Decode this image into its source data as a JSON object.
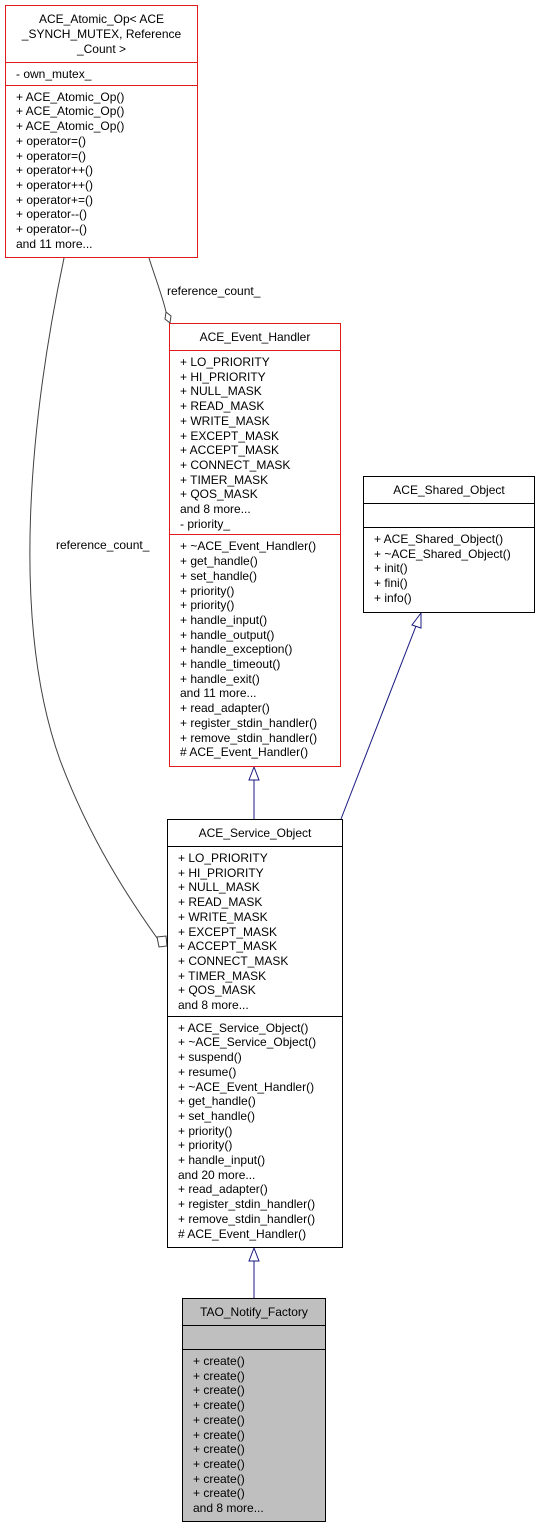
{
  "diagram": {
    "colors": {
      "red_border": "#e01b1b",
      "inherit_edge": "#1a1a80",
      "member_edge": "#404040",
      "focus_fill": "#bfbfbf"
    },
    "classes": {
      "atomic_op": {
        "title_lines": [
          "ACE_Atomic_Op< ACE",
          "_SYNCH_MUTEX, Reference",
          "_Count >"
        ],
        "attributes": [
          "- own_mutex_"
        ],
        "methods": [
          "+ ACE_Atomic_Op()",
          "+ ACE_Atomic_Op()",
          "+ ACE_Atomic_Op()",
          "+ operator=()",
          "+ operator=()",
          "+ operator++()",
          "+ operator++()",
          "+ operator+=()",
          "+ operator--()",
          "+ operator--()",
          "and 11 more..."
        ]
      },
      "event_handler": {
        "title": "ACE_Event_Handler",
        "attributes": [
          "+ LO_PRIORITY",
          "+ HI_PRIORITY",
          "+ NULL_MASK",
          "+ READ_MASK",
          "+ WRITE_MASK",
          "+ EXCEPT_MASK",
          "+ ACCEPT_MASK",
          "+ CONNECT_MASK",
          "+ TIMER_MASK",
          "+ QOS_MASK",
          "and 8 more...",
          "- priority_"
        ],
        "methods": [
          "+ ~ACE_Event_Handler()",
          "+ get_handle()",
          "+ set_handle()",
          "+ priority()",
          "+ priority()",
          "+ handle_input()",
          "+ handle_output()",
          "+ handle_exception()",
          "+ handle_timeout()",
          "+ handle_exit()",
          "and 11 more...",
          "+ read_adapter()",
          "+ register_stdin_handler()",
          "+ remove_stdin_handler()",
          "# ACE_Event_Handler()"
        ]
      },
      "shared_object": {
        "title": "ACE_Shared_Object",
        "attributes": [],
        "methods": [
          "+ ACE_Shared_Object()",
          "+ ~ACE_Shared_Object()",
          "+ init()",
          "+ fini()",
          "+ info()"
        ]
      },
      "service_object": {
        "title": "ACE_Service_Object",
        "attributes": [
          "+ LO_PRIORITY",
          "+ HI_PRIORITY",
          "+ NULL_MASK",
          "+ READ_MASK",
          "+ WRITE_MASK",
          "+ EXCEPT_MASK",
          "+ ACCEPT_MASK",
          "+ CONNECT_MASK",
          "+ TIMER_MASK",
          "+ QOS_MASK",
          "and 8 more..."
        ],
        "methods": [
          "+ ACE_Service_Object()",
          "+ ~ACE_Service_Object()",
          "+ suspend()",
          "+ resume()",
          "+ ~ACE_Event_Handler()",
          "+ get_handle()",
          "+ set_handle()",
          "+ priority()",
          "+ priority()",
          "+ handle_input()",
          "and 20 more...",
          "+ read_adapter()",
          "+ register_stdin_handler()",
          "+ remove_stdin_handler()",
          "# ACE_Event_Handler()"
        ]
      },
      "notify_factory": {
        "title": "TAO_Notify_Factory",
        "attributes": [],
        "methods": [
          "+ create()",
          "+ create()",
          "+ create()",
          "+ create()",
          "+ create()",
          "+ create()",
          "+ create()",
          "+ create()",
          "+ create()",
          "+ create()",
          "and 8 more..."
        ]
      }
    },
    "edge_labels": {
      "ref_count_event_handler": "reference_count_",
      "ref_count_service_object": "reference_count_"
    }
  }
}
